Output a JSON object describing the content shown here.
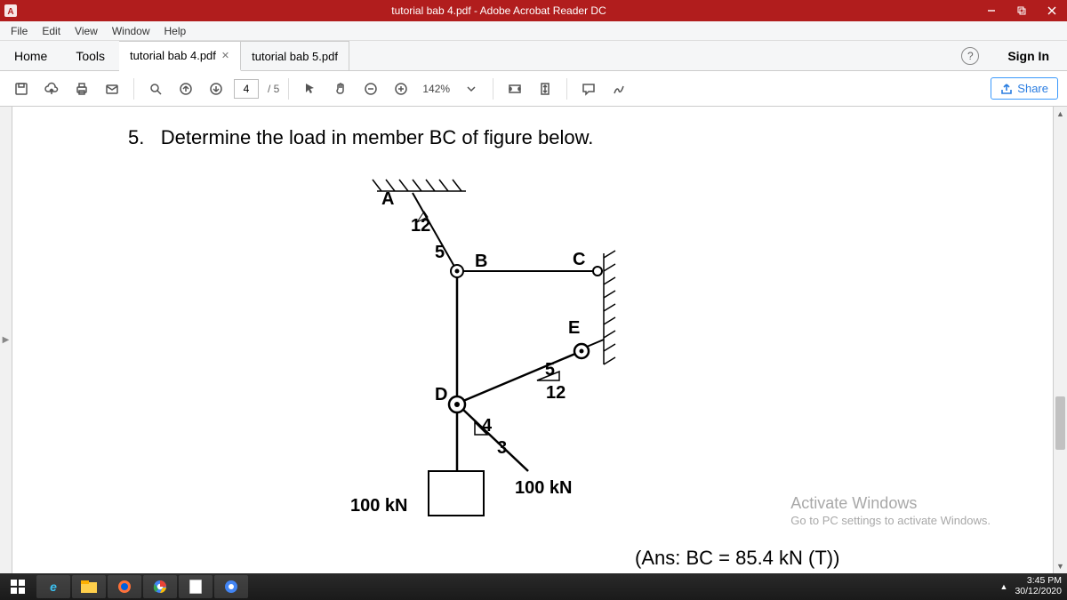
{
  "titlebar": {
    "title": "tutorial bab 4.pdf - Adobe Acrobat Reader DC"
  },
  "menubar": {
    "items": [
      "File",
      "Edit",
      "View",
      "Window",
      "Help"
    ]
  },
  "tabbar": {
    "home": "Home",
    "tools": "Tools",
    "docs": [
      {
        "label": "tutorial bab 4.pdf",
        "active": true
      },
      {
        "label": "tutorial bab 5.pdf",
        "active": false
      }
    ],
    "signin": "Sign In"
  },
  "toolbar": {
    "page_current": "4",
    "page_total": "/ 5",
    "zoom": "142%",
    "share": "Share"
  },
  "document": {
    "question_number": "5.",
    "question_text": "Determine the load in member BC of figure below.",
    "figure": {
      "points": {
        "A": "A",
        "B": "B",
        "C": "C",
        "D": "D",
        "E": "E"
      },
      "dims": {
        "AB12": "12",
        "AB5": "5",
        "DE5": "5",
        "DE12": "12",
        "bot4": "4",
        "bot3": "3"
      },
      "load_left": "100 kN",
      "load_right": "100 kN"
    },
    "answer": "(Ans: BC = 85.4 kN (T))"
  },
  "watermark": {
    "line1": "Activate Windows",
    "line2": "Go to PC settings to activate Windows."
  },
  "taskbar": {
    "time": "3:45 PM",
    "date": "30/12/2020"
  }
}
